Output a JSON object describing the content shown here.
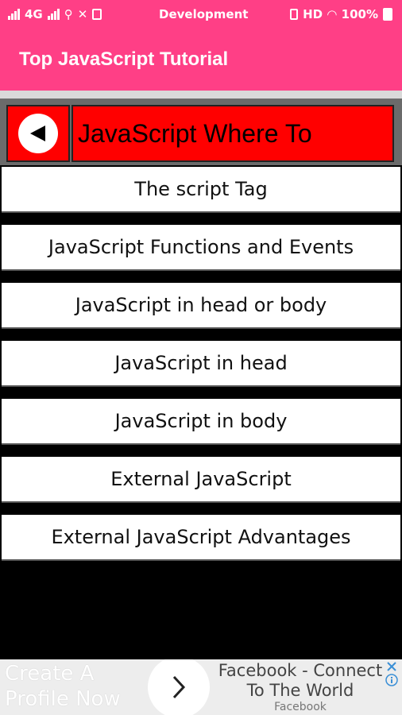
{
  "status_bar": {
    "network": "4G",
    "app_label": "Development",
    "hd_label": "HD",
    "battery": "100%"
  },
  "app_bar": {
    "title": "Top JavaScript Tutorial"
  },
  "section_header": {
    "title": "JavaScript Where To"
  },
  "menu": {
    "items": [
      {
        "label": "The script Tag"
      },
      {
        "label": "JavaScript Functions and Events"
      },
      {
        "label": "JavaScript in head or body"
      },
      {
        "label": "JavaScript in head"
      },
      {
        "label": "JavaScript in body"
      },
      {
        "label": "External JavaScript"
      },
      {
        "label": "External JavaScript Advantages"
      }
    ]
  },
  "ad": {
    "left_line1": "Create A",
    "left_line2": "Profile Now",
    "right_line1": "Facebook - Connect",
    "right_line2": "To The World",
    "brand": "Facebook",
    "icons": [
      "close-icon",
      "info-icon"
    ]
  },
  "colors": {
    "accent": "#ff3f86",
    "header_red": "#ff0000",
    "background": "#000000"
  }
}
